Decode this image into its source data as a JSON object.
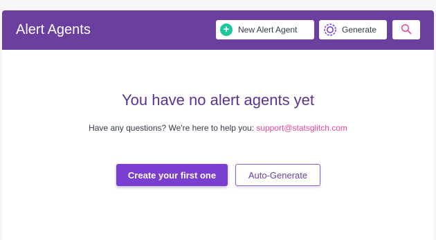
{
  "header": {
    "title": "Alert Agents",
    "new_button_label": "New Alert Agent",
    "generate_button_label": "Generate",
    "search_icon": "search-icon",
    "plus_icon": "plus-icon",
    "generate_icon": "generate-gear-icon"
  },
  "empty_state": {
    "title": "You have no alert agents yet",
    "subtitle_prefix": "Have any questions? We're here to help you: ",
    "support_email": "support@statsglitch.com",
    "create_button_label": "Create your first one",
    "autogen_button_label": "Auto-Generate"
  },
  "colors": {
    "header_bg": "#6b3fa0",
    "accent": "#7a3fd0",
    "link": "#e0479a",
    "plus_icon_bg": "#1cc7a0"
  }
}
